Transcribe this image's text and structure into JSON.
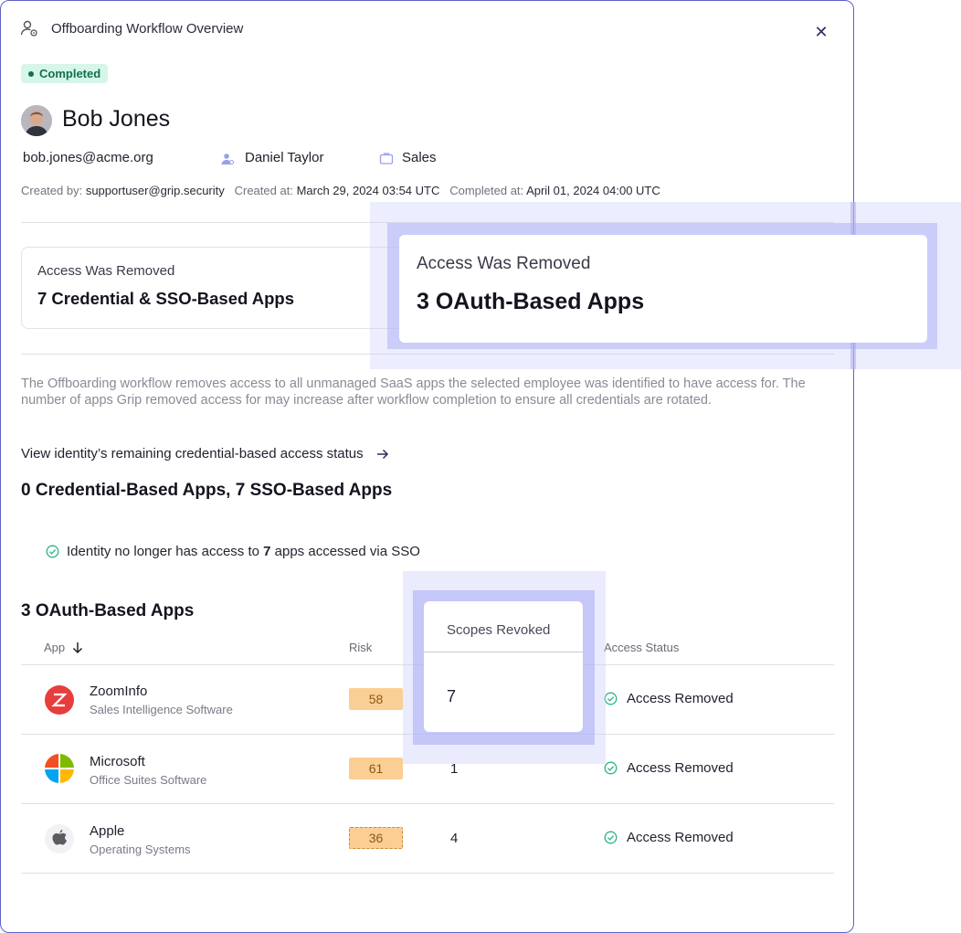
{
  "header": {
    "title": "Offboarding Workflow Overview",
    "close_icon": "close-icon",
    "title_icon": "user-settings-icon"
  },
  "status": {
    "label": "Completed",
    "color": "#12704b"
  },
  "person": {
    "name": "Bob Jones",
    "email": "bob.jones@acme.org",
    "manager": "Daniel Taylor",
    "department": "Sales"
  },
  "created": {
    "by_label": "Created by:",
    "by_value": "supportuser@grip.security",
    "at_label": "Created at:",
    "at_value": "March 29, 2024 03:54 UTC",
    "completed_label": "Completed at:",
    "completed_value": "April 01, 2024 04:00 UTC"
  },
  "cards": [
    {
      "label": "Access Was Removed",
      "value": "7 Credential & SSO-Based Apps"
    },
    {
      "label": "Access Was Removed",
      "value": "3 OAuth-Based Apps"
    }
  ],
  "description": "The Offboarding workflow removes access to all unmanaged SaaS apps the selected employee was identified to have access for. The number of apps Grip removed access for may increase after workflow completion to ensure all credentials are rotated.",
  "link": {
    "label": "View identity’s remaining credential-based access status"
  },
  "credential_section": {
    "title": "0 Credential-Based Apps, 7 SSO-Based Apps",
    "note_prefix": "Identity no longer has access to ",
    "note_count": "7",
    "note_suffix": " apps accessed via SSO"
  },
  "oauth_section": {
    "title": "3 OAuth-Based Apps",
    "columns": {
      "app": "App",
      "risk": "Risk",
      "scopes": "Scopes Revoked",
      "status": "Access Status"
    },
    "rows": [
      {
        "name": "ZoomInfo",
        "category": "Sales Intelligence Software",
        "risk": "58",
        "scopes": "7",
        "status": "Access Removed",
        "icon": "zoominfo-logo-icon"
      },
      {
        "name": "Microsoft",
        "category": "Office Suites Software",
        "risk": "61",
        "scopes": "1",
        "status": "Access Removed",
        "icon": "microsoft-logo-icon"
      },
      {
        "name": "Apple",
        "category": "Operating Systems",
        "risk": "36",
        "scopes": "4",
        "status": "Access Removed",
        "icon": "apple-logo-icon"
      }
    ]
  },
  "colors": {
    "accent": "#5d63c9",
    "success": "#2bb38a",
    "risk_bg": "#fbcf94"
  }
}
